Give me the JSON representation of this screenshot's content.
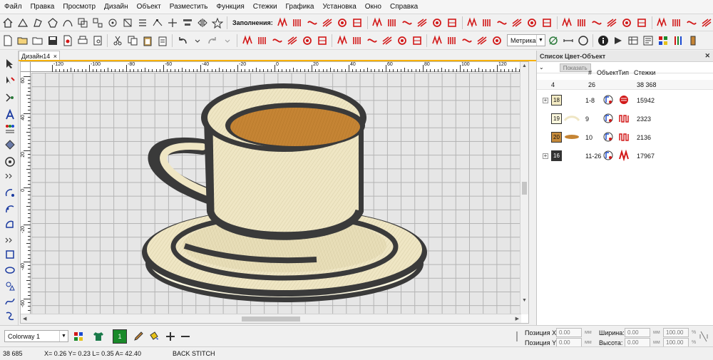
{
  "menu": [
    "Файл",
    "Правка",
    "Просмотр",
    "Дизайн",
    "Объект",
    "Разместить",
    "Функция",
    "Стежки",
    "Графика",
    "Установка",
    "Окно",
    "Справка"
  ],
  "toolbar": {
    "fill_label": "Заполнения:",
    "units_select": "Метрика"
  },
  "document": {
    "tab_title": "Дизайн14",
    "close_glyph": "×"
  },
  "rulers": {
    "h_labels": [
      "-120",
      "-100",
      "-80",
      "-60",
      "-40",
      "-20",
      "0",
      "20",
      "40",
      "60",
      "80",
      "100",
      "120"
    ],
    "v_labels": [
      "60",
      "40",
      "20",
      "0",
      "-20",
      "-40",
      "-60"
    ]
  },
  "panel": {
    "title": "Список Цвет-Объект",
    "show_button": "Показать",
    "columns": {
      "num": "#",
      "object": "Объект",
      "type": "Тип",
      "stitches": "Стежки"
    },
    "summary": {
      "colors": "4",
      "objects": "26",
      "stitches": "38 368"
    },
    "rows": [
      {
        "expand": "+",
        "color_num": "18",
        "swatch": "#f3ebc4",
        "range": "1-8",
        "stitches": "15942",
        "type_icon": "satin-fill-icon"
      },
      {
        "expand": "",
        "color_num": "19",
        "swatch": "#fbf7dd",
        "range": "9",
        "stitches": "2323",
        "type_icon": "zigzag-icon"
      },
      {
        "expand": "",
        "color_num": "20",
        "swatch": "#c68a3a",
        "range": "10",
        "stitches": "2136",
        "type_icon": "zigzag-icon"
      },
      {
        "expand": "+",
        "color_num": "16",
        "swatch": "#333333",
        "range": "11-26",
        "stitches": "17967",
        "type_icon": "satin-line-icon"
      }
    ]
  },
  "bottom_toolbar": {
    "colorway": "Colorway 1",
    "active_color": "1",
    "pos_x_label": "Позиция X:",
    "pos_y_label": "Позиция Y:",
    "pos_x": "0.00",
    "pos_y": "0.00",
    "width_label": "Ширина:",
    "height_label": "Высота:",
    "width": "0.00",
    "height": "0.00",
    "width_pct": "100.00",
    "height_pct": "100.00",
    "unit_mm": "мм",
    "unit_pct": "%"
  },
  "status": {
    "stitches": "38 685",
    "coords": "X=  0.26 Y=  0.23 L=  0.35 A=  42.40",
    "stitch_type": "BACK STITCH"
  },
  "colors": {
    "accent": "#f7b100",
    "toolbar_red": "#d21919",
    "cup_cream": "#f1e8c8",
    "coffee": "#c58434",
    "outline": "#3a3a3a"
  }
}
